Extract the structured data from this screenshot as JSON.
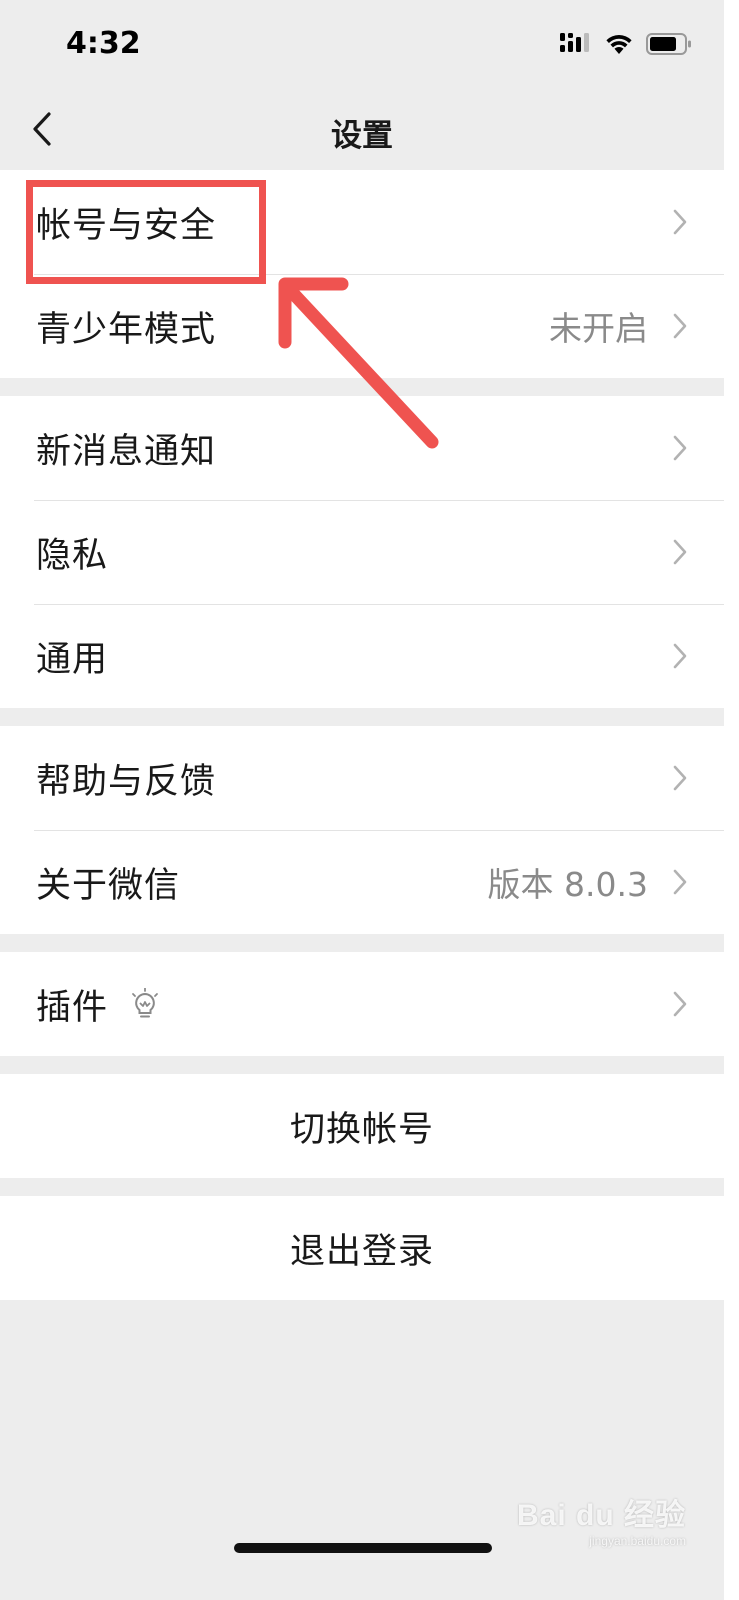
{
  "status_bar": {
    "time": "4:32",
    "icons": [
      "cellular-signal-icon",
      "wifi-icon",
      "battery-icon"
    ]
  },
  "nav": {
    "title": "设置",
    "back_icon": "chevron-left-icon"
  },
  "groups": [
    {
      "items": [
        {
          "label": "帐号与安全",
          "value": ""
        },
        {
          "label": "青少年模式",
          "value": "未开启"
        }
      ]
    },
    {
      "items": [
        {
          "label": "新消息通知",
          "value": ""
        },
        {
          "label": "隐私",
          "value": ""
        },
        {
          "label": "通用",
          "value": ""
        }
      ]
    },
    {
      "items": [
        {
          "label": "帮助与反馈",
          "value": ""
        },
        {
          "label": "关于微信",
          "value": "版本 8.0.3"
        }
      ]
    },
    {
      "items": [
        {
          "label": "插件",
          "value": "",
          "icon": "lightbulb-icon"
        }
      ]
    }
  ],
  "actions": {
    "switch_account": "切换帐号",
    "logout": "退出登录"
  },
  "watermark": {
    "logo": "Bai du 经验",
    "sub": "jingyan.baidu.com"
  },
  "colors": {
    "background": "#ededed",
    "cell": "#ffffff",
    "text": "#191919",
    "secondary_text": "#8a8a8a",
    "annotation": "#ef5350"
  }
}
